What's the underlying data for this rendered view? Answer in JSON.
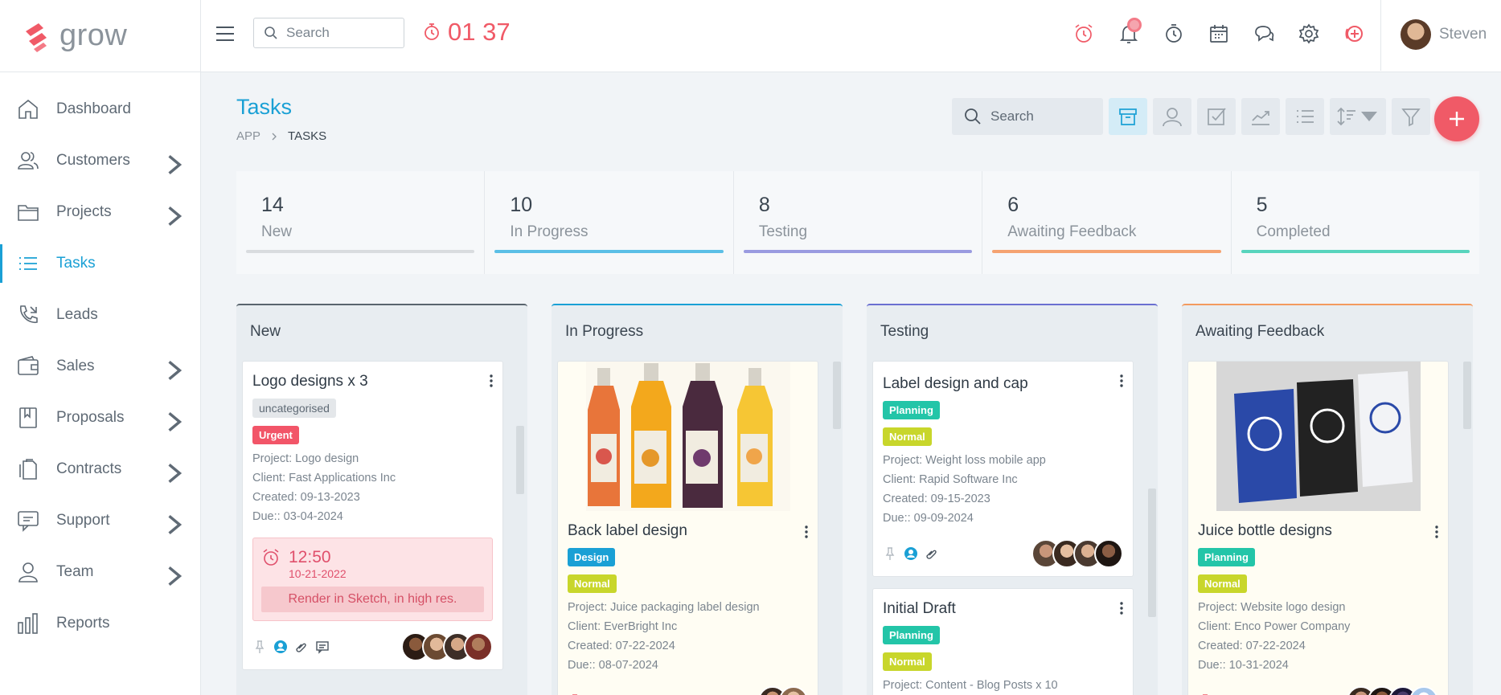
{
  "brand": {
    "name": "grow",
    "logo_color": "#f05a67"
  },
  "sidebar": {
    "items": [
      {
        "label": "Dashboard",
        "icon": "home-icon",
        "has_children": false
      },
      {
        "label": "Customers",
        "icon": "users-icon",
        "has_children": true
      },
      {
        "label": "Projects",
        "icon": "folder-icon",
        "has_children": true
      },
      {
        "label": "Tasks",
        "icon": "list-icon",
        "has_children": false,
        "active": true
      },
      {
        "label": "Leads",
        "icon": "phone-icon",
        "has_children": false
      },
      {
        "label": "Sales",
        "icon": "wallet-icon",
        "has_children": true
      },
      {
        "label": "Proposals",
        "icon": "bookmark-icon",
        "has_children": true
      },
      {
        "label": "Contracts",
        "icon": "documents-icon",
        "has_children": true
      },
      {
        "label": "Support",
        "icon": "chat-icon",
        "has_children": true
      },
      {
        "label": "Team",
        "icon": "user-icon",
        "has_children": true
      },
      {
        "label": "Reports",
        "icon": "bar-chart-icon",
        "has_children": false
      }
    ]
  },
  "topbar": {
    "search_placeholder": "Search",
    "timer": "01 37",
    "icons": [
      "alarm-clock-icon",
      "bell-icon",
      "stopwatch-icon",
      "calendar-icon",
      "chat-bubbles-icon",
      "gear-icon",
      "add-circle-icon"
    ],
    "user_name": "Steven"
  },
  "page": {
    "title": "Tasks",
    "breadcrumb": [
      "APP",
      "TASKS"
    ],
    "search_placeholder": "Search",
    "tool_icons": [
      "archive-icon",
      "user-filter-icon",
      "checkbox-icon",
      "trend-icon",
      "list-view-icon",
      "sort-icon",
      "filter-icon"
    ]
  },
  "stats": [
    {
      "count": "14",
      "label": "New",
      "color": "#d9dcdf"
    },
    {
      "count": "10",
      "label": "In Progress",
      "color": "#5bbfe6"
    },
    {
      "count": "8",
      "label": "Testing",
      "color": "#9a9be0"
    },
    {
      "count": "6",
      "label": "Awaiting Feedback",
      "color": "#f5a371"
    },
    {
      "count": "5",
      "label": "Completed",
      "color": "#58d4bd"
    }
  ],
  "columns": [
    {
      "title": "New",
      "color": "#59646e",
      "cards": [
        {
          "title": "Logo designs x 3",
          "category": "uncategorised",
          "tags": [
            "Urgent"
          ],
          "project": "Project: Logo design",
          "client": "Client: Fast Applications Inc",
          "created": "Created: 09-13-2023",
          "due": "Due:: 03-04-2024",
          "reminder_time": "12:50",
          "reminder_date": "10-21-2022",
          "reminder_note": "Render in Sketch, in high res."
        }
      ]
    },
    {
      "title": "In Progress",
      "color": "#1aa0d5",
      "cards": [
        {
          "title": "Back label design",
          "tags": [
            "Design",
            "Normal"
          ],
          "project": "Project: Juice packaging label design",
          "client": "Client: EverBright Inc",
          "created": "Created: 07-22-2024",
          "due": "Due:: 08-07-2024"
        }
      ]
    },
    {
      "title": "Testing",
      "color": "#6a6fd1",
      "cards": [
        {
          "title": "Label design and cap",
          "tags": [
            "Planning",
            "Normal"
          ],
          "project": "Project: Weight loss mobile app",
          "client": "Client: Rapid Software Inc",
          "created": "Created: 09-15-2023",
          "due": "Due:: 09-09-2024"
        },
        {
          "title": "Initial Draft",
          "tags": [
            "Planning",
            "Normal"
          ],
          "project": "Project: Content - Blog Posts x 10"
        }
      ]
    },
    {
      "title": "Awaiting Feedback",
      "color": "#f39a5e",
      "cards": [
        {
          "title": "Juice bottle designs",
          "tags": [
            "Planning",
            "Normal"
          ],
          "project": "Project: Website logo design",
          "client": "Client: Enco Power Company",
          "created": "Created: 07-22-2024",
          "due": "Due:: 10-31-2024"
        }
      ]
    }
  ]
}
